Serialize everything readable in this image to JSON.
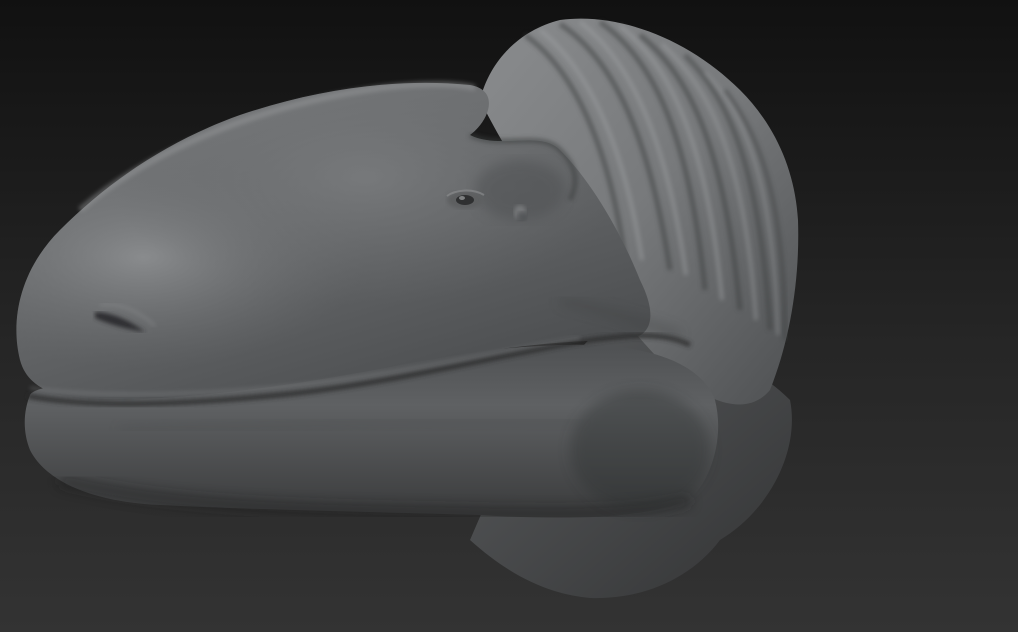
{
  "scene": {
    "subject": "sculpted-creature-head",
    "background_top_color": "#111111",
    "background_bottom_color": "#333333",
    "material_base_color": "#6f7173",
    "material_highlight_color": "#9a9c9e",
    "material_shadow_color": "#2d2e2f"
  }
}
